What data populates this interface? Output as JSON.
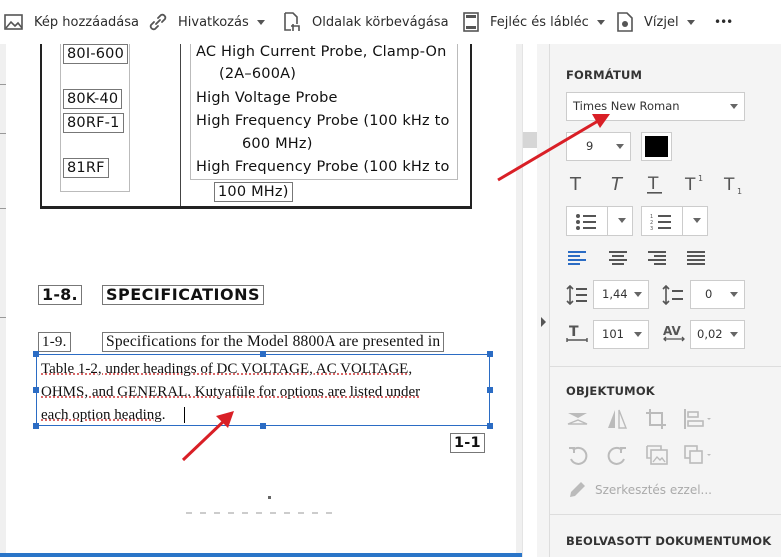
{
  "toolbar": {
    "add_image": "Kép hozzáadása",
    "link": "Hivatkozás",
    "crop_pages": "Oldalak körbevágása",
    "header_footer": "Fejléc és lábléc",
    "watermark": "Vízjel",
    "more": "•••"
  },
  "document": {
    "table_rows": [
      {
        "code": "80I-600",
        "desc": "AC High Current Probe, Clamp-On",
        "desc2": "(2A–600A)"
      },
      {
        "code": "80K-40",
        "desc": "High Voltage Probe"
      },
      {
        "code": "80RF-1",
        "desc": "High Frequency Probe (100 kHz to",
        "desc2": "600 MHz)"
      },
      {
        "code": "81RF",
        "desc": "High Frequency Probe (100 kHz to",
        "desc2": "100 MHz)"
      }
    ],
    "section_number": "1-8.",
    "section_title": "SPECIFICATIONS",
    "para_number": "1-9.",
    "para_line1": "Specifications for the Model 8800A are presented in",
    "edit_lines": [
      "Table 1-2, under headings of DC VOLTAGE, AC VOLTAGE,",
      "OHMS, and GENERAL.  Kutyafüle for options are listed under",
      "each option heading."
    ],
    "page_number": "1-1"
  },
  "panel": {
    "format_title": "FORMÁTUM",
    "font_family": "Times New Roman",
    "font_size": "9",
    "text_color": "#000000",
    "line_spacing": "1,44",
    "para_spacing": "0",
    "scale": "101",
    "char_spacing": "0,02",
    "objects_title": "OBJEKTUMOK",
    "edit_with": "Szerkesztés ezzel...",
    "scanned_title": "BEOLVASOTT DOKUMENTUMOK"
  },
  "colors": {
    "accent_blue": "#2b6cc4",
    "arrow_red": "#d91f26"
  }
}
